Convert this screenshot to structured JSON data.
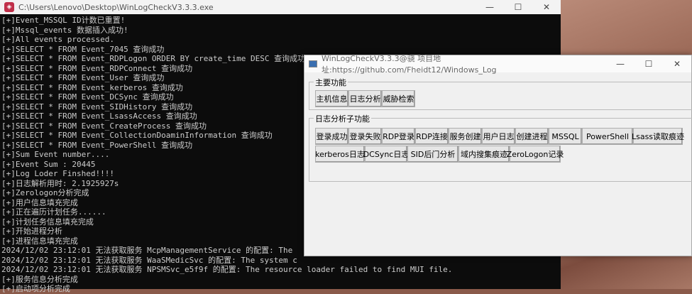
{
  "console": {
    "title": "C:\\Users\\Lenovo\\Desktop\\WinLogCheckV3.3.3.exe",
    "lines": [
      "[+]Event_MSSQL ID计数已重置!",
      "[+]Mssql_events 数据插入成功!",
      "[+]All events processed.",
      "[+]SELECT * FROM Event_7045 查询成功",
      "[+]SELECT * FROM Event_RDPLogon ORDER BY create_time DESC 查询成功",
      "[+]SELECT * FROM Event_RDPConnect 查询成功",
      "[+]SELECT * FROM Event_User 查询成功",
      "[+]SELECT * FROM Event_kerberos 查询成功",
      "[+]SELECT * FROM Event_DCSync 查询成功",
      "[+]SELECT * FROM Event_SIDHistory 查询成功",
      "[+]SELECT * FROM Event_LsassAccess 查询成功",
      "[+]SELECT * FROM Event_CreateProcess 查询成功",
      "[+]SELECT * FROM Event_CollectionDoaminInformation 查询成功",
      "[+]SELECT * FROM Event_PowerShell 查询成功",
      "[+]Sum Event number....",
      "[+]Event Sum : 20445",
      "[+]Log Loder Finshed!!!!",
      "[+]日志解析用时: 2.1925927s",
      "[+]Zerologon分析完成",
      "[+]用户信息填充完成",
      "[+]正在遍历计划任务......",
      "[+]计划任务信息填充完成",
      "[+]开始进程分析",
      "[+]进程信息填充完成",
      "2024/12/02 23:12:01 无法获取服务 McpManagementService 的配置: The",
      "2024/12/02 23:12:01 无法获取服务 WaaSMedicSvc 的配置: The system c",
      "2024/12/02 23:12:01 无法获取服务 NPSMSvc_e5f9f 的配置: The resource loader failed to find MUI file.",
      "[+]服务信息分析完成",
      "[+]启动项分析完成"
    ]
  },
  "dialog": {
    "title": "WinLogCheckV3.3.3@骁 项目地址:https://github.com/Fheidt12/Windows_Log",
    "main_group": "主要功能",
    "main_buttons": [
      "主机信息",
      "日志分析",
      "威胁检索"
    ],
    "sub_group": "日志分析子功能",
    "sub_row1": [
      "登录成功",
      "登录失败",
      "RDP登录",
      "RDP连接",
      "服务创建",
      "用户日志",
      "创建进程",
      "MSSQL",
      "PowerShell",
      "Lsass读取痕迹"
    ],
    "sub_row2": [
      "kerberos日志",
      "DCSync日志",
      "SID后门分析",
      "域内搜集痕迹",
      "ZeroLogon记录"
    ]
  },
  "window_controls": {
    "minimize": "—",
    "maximize": "☐",
    "close": "✕"
  }
}
